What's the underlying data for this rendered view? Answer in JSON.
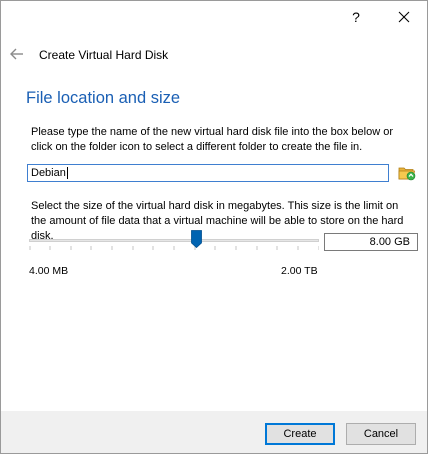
{
  "titlebar": {
    "help_label": "?",
    "close_icon": "close-icon"
  },
  "header": {
    "back_icon": "back-arrow-icon",
    "title": "Create Virtual Hard Disk"
  },
  "section_title": "File location and size",
  "file_description": "Please type the name of the new virtual hard disk file into the box below or click on the folder icon to select a different folder to create the file in.",
  "file_name": {
    "value": "Debian"
  },
  "folder_icon": "folder-icon",
  "size_description": "Select the size of the virtual hard disk in megabytes. This size is the limit on the amount of file data that a virtual machine will be able to store on the hard disk.",
  "size": {
    "value": "8.00 GB",
    "slider_fraction": 0.575,
    "min_label": "4.00 MB",
    "max_label": "2.00 TB"
  },
  "buttons": {
    "create": "Create",
    "cancel": "Cancel"
  },
  "colors": {
    "accent": "#0078d7",
    "title_blue": "#1a5fb4",
    "thumb": "#0063b1"
  }
}
